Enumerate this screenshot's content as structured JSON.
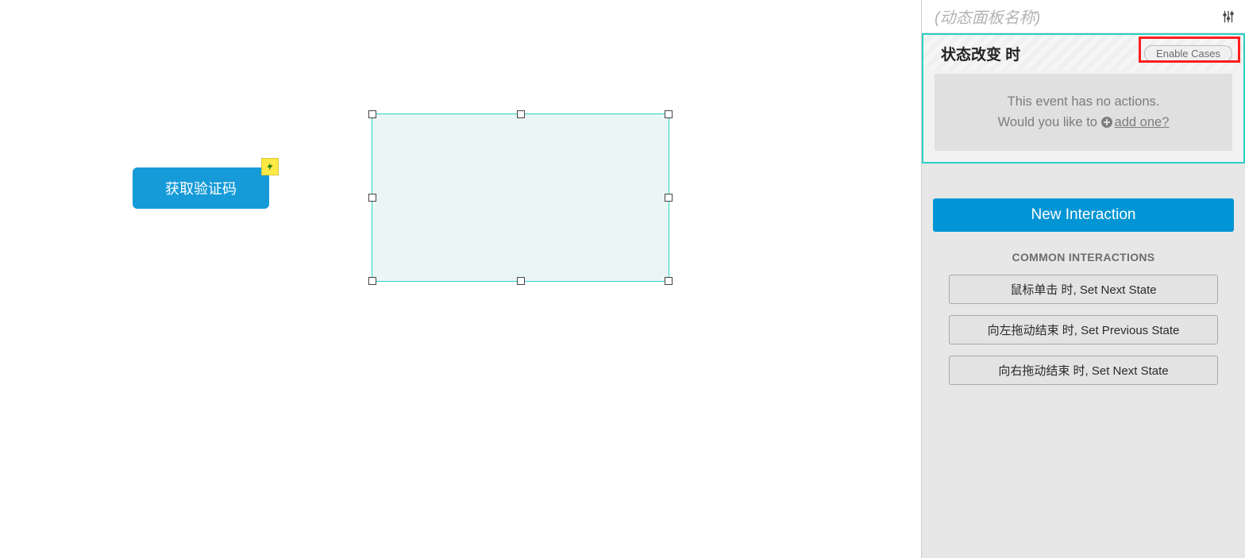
{
  "canvas": {
    "verify_button_label": "获取验证码"
  },
  "inspector": {
    "panel_name_placeholder": "(动态面板名称)",
    "event": {
      "title": "状态改变 时",
      "enable_cases_label": "Enable Cases",
      "no_actions_line1": "This event has no actions.",
      "no_actions_line2_prefix": "Would you like to ",
      "add_one_label": "add one?"
    },
    "new_interaction_label": "New Interaction",
    "common_interactions_header": "COMMON INTERACTIONS",
    "common_interactions": [
      "鼠标单击 时, Set Next State",
      "向左拖动结束 时, Set Previous State",
      "向右拖动结束 时, Set Next State"
    ]
  }
}
